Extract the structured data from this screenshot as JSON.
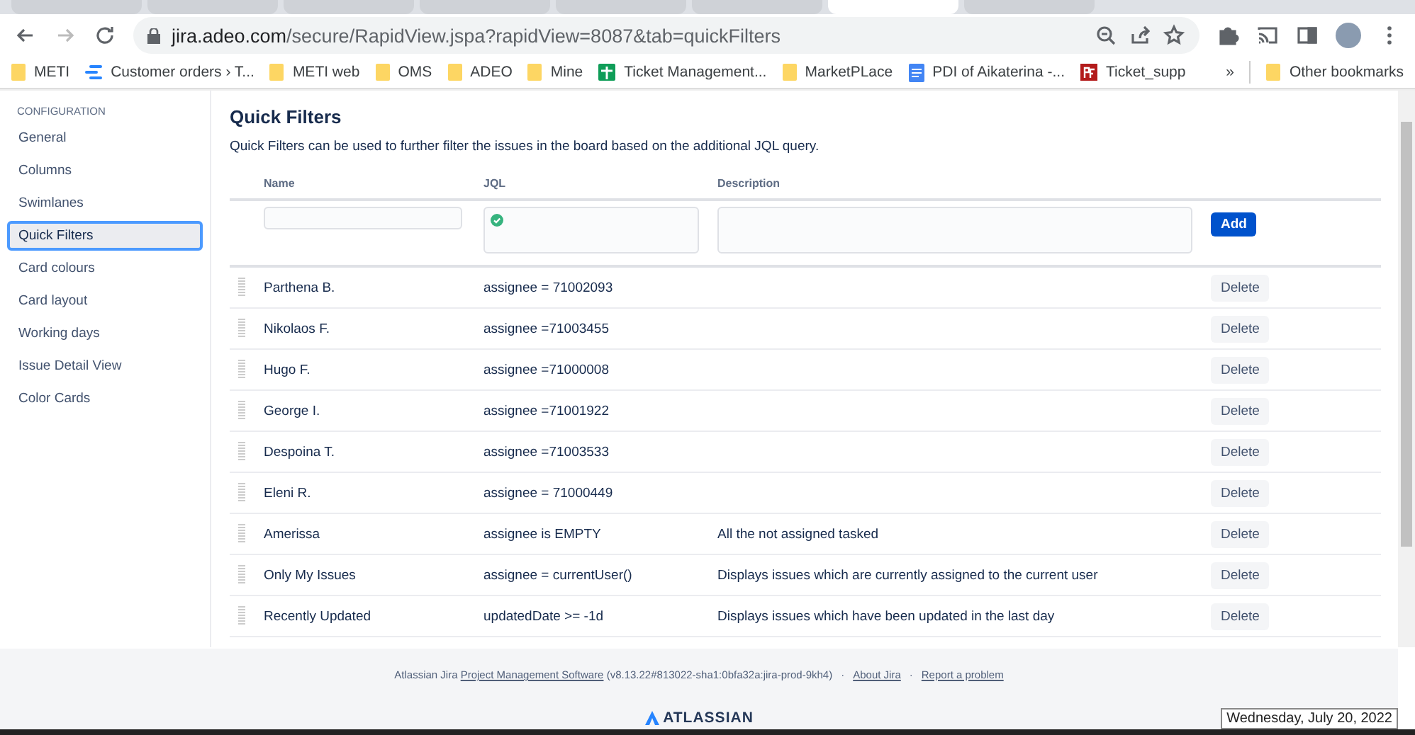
{
  "browser": {
    "tabs": [
      {
        "selected": false
      },
      {
        "selected": false
      },
      {
        "selected": false
      },
      {
        "selected": false
      },
      {
        "selected": false
      },
      {
        "selected": false
      },
      {
        "selected": true
      },
      {
        "selected": false
      }
    ],
    "url_host": "jira.adeo.com",
    "url_path": "/secure/RapidView.jspa?rapidView=8087&tab=quickFilters",
    "bookmarks": [
      {
        "label": "METI",
        "kind": "folder"
      },
      {
        "label": "Customer orders › T...",
        "kind": "board"
      },
      {
        "label": "METI web",
        "kind": "folder"
      },
      {
        "label": "OMS",
        "kind": "folder"
      },
      {
        "label": "ADEO",
        "kind": "folder"
      },
      {
        "label": "Mine",
        "kind": "folder"
      },
      {
        "label": "Ticket Management...",
        "kind": "sheet"
      },
      {
        "label": "MarketPLace",
        "kind": "folder"
      },
      {
        "label": "PDI of Aikaterina -...",
        "kind": "doc"
      },
      {
        "label": "Ticket_supp",
        "kind": "pdf"
      }
    ],
    "overflow": "»",
    "other_bookmarks": "Other bookmarks"
  },
  "sidebar": {
    "heading": "CONFIGURATION",
    "items": [
      {
        "label": "General",
        "selected": false
      },
      {
        "label": "Columns",
        "selected": false
      },
      {
        "label": "Swimlanes",
        "selected": false
      },
      {
        "label": "Quick Filters",
        "selected": true
      },
      {
        "label": "Card colours",
        "selected": false
      },
      {
        "label": "Card layout",
        "selected": false
      },
      {
        "label": "Working days",
        "selected": false
      },
      {
        "label": "Issue Detail View",
        "selected": false
      },
      {
        "label": "Color Cards",
        "selected": false
      }
    ]
  },
  "main": {
    "title": "Quick Filters",
    "description": "Quick Filters can be used to further filter the issues in the board based on the additional JQL query.",
    "columns": [
      "Name",
      "JQL",
      "Description"
    ],
    "add_button": "Add",
    "filters": [
      {
        "name": "Parthena B.",
        "jql": "assignee = 71002093",
        "delete": "Delete"
      },
      {
        "name": "Nikolaos F.",
        "jql": "assignee =71003455",
        "delete": "Delete"
      },
      {
        "name": "Hugo F.",
        "jql": "assignee =71000008",
        "delete": "Delete"
      },
      {
        "name": "George I.",
        "jql": "assignee =71001922",
        "delete": "Delete"
      },
      {
        "name": "Despoina T.",
        "jql": "assignee =71003533",
        "delete": "Delete"
      },
      {
        "name": "Eleni R.",
        "jql": "assignee = 71000449",
        "delete": "Delete"
      },
      {
        "name": "Amerissa",
        "jql": "assignee is EMPTY",
        "description": "All the not assigned tasked",
        "delete": "Delete"
      },
      {
        "name": "Only My Issues",
        "jql": "assignee = currentUser()",
        "description": "Displays issues which are currently assigned to the current user",
        "delete": "Delete"
      },
      {
        "name": "Recently Updated",
        "jql": "updatedDate >= -1d",
        "description": "Displays issues which have been updated in the last day",
        "delete": "Delete"
      }
    ]
  },
  "footer": {
    "prefix": "Atlassian Jira",
    "link": "Project Management Software",
    "version": "(v8.13.22#813022-sha1:0bfa32a:jira-prod-9kh4)",
    "separator": "·",
    "about": "About Jira",
    "report": "Report a problem",
    "logo": "ATLASSIAN"
  },
  "date_tooltip": "Wednesday, July 20, 2022"
}
